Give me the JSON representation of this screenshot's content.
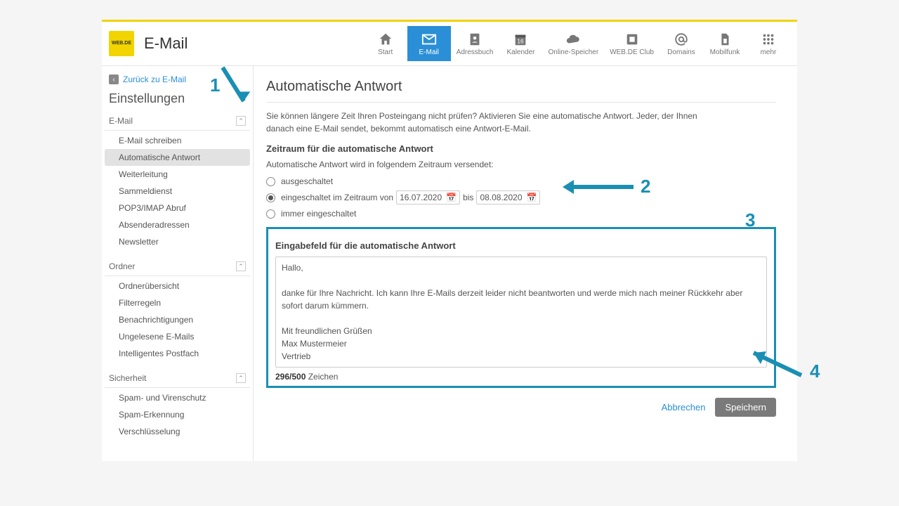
{
  "brand": {
    "logo_text": "WEB.DE",
    "app_title": "E-Mail"
  },
  "nav": {
    "items": [
      {
        "label": "Start",
        "icon": "home"
      },
      {
        "label": "E-Mail",
        "icon": "mail",
        "active": true
      },
      {
        "label": "Adressbuch",
        "icon": "contacts"
      },
      {
        "label": "Kalender",
        "icon": "calendar",
        "badge": "16"
      },
      {
        "label": "Online-Speicher",
        "icon": "cloud"
      },
      {
        "label": "WEB.DE Club",
        "icon": "club"
      },
      {
        "label": "Domains",
        "icon": "at"
      },
      {
        "label": "Mobilfunk",
        "icon": "sim"
      },
      {
        "label": "mehr",
        "icon": "grid"
      }
    ]
  },
  "sidebar": {
    "back_label": "Zurück zu E-Mail",
    "title": "Einstellungen",
    "sections": [
      {
        "title": "E-Mail",
        "items": [
          "E-Mail schreiben",
          "Automatische Antwort",
          "Weiterleitung",
          "Sammeldienst",
          "POP3/IMAP Abruf",
          "Absenderadressen",
          "Newsletter"
        ],
        "active_index": 1
      },
      {
        "title": "Ordner",
        "items": [
          "Ordnerübersicht",
          "Filterregeln",
          "Benachrichtigungen",
          "Ungelesene E-Mails",
          "Intelligentes Postfach"
        ]
      },
      {
        "title": "Sicherheit",
        "items": [
          "Spam- und Virenschutz",
          "Spam-Erkennung",
          "Verschlüsselung"
        ]
      }
    ]
  },
  "main": {
    "title": "Automatische Antwort",
    "intro": "Sie können längere Zeit Ihren Posteingang nicht prüfen? Aktivieren Sie eine automatische Antwort. Jeder, der Ihnen danach eine E-Mail sendet, bekommt automatisch eine Antwort-E-Mail.",
    "period_heading": "Zeitraum für die automatische Antwort",
    "period_note": "Automatische Antwort wird in folgendem Zeitraum versendet:",
    "options": {
      "off": "ausgeschaltet",
      "range_prefix": "eingeschaltet im Zeitraum von",
      "range_mid": "bis",
      "always": "immer eingeschaltet",
      "selected": "range",
      "date_from": "16.07.2020",
      "date_to": "08.08.2020"
    },
    "message_heading": "Eingabefeld für die automatische Antwort",
    "message_body": "Hallo,\n\ndanke für Ihre Nachricht. Ich kann Ihre E-Mails derzeit leider nicht beantworten und werde mich nach meiner Rückkehr aber sofort darum kümmern.\n\nMit freundlichen Grüßen\nMax Mustermeier\nVertrieb",
    "char_count": "296/500",
    "char_suffix": " Zeichen",
    "cancel": "Abbrechen",
    "save": "Speichern"
  },
  "annotations": {
    "n1": "1",
    "n2": "2",
    "n3": "3",
    "n4": "4"
  }
}
